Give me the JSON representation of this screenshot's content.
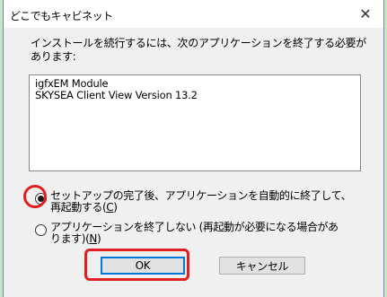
{
  "window": {
    "title": "どこでもキャビネット",
    "close_glyph": "✕"
  },
  "message": "インストールを続行するには、次のアプリケーションを終了する必要があります:",
  "applications": [
    "igfxEM Module",
    "SKYSEA Client View Version 13.2"
  ],
  "options": [
    {
      "label_line1": "セットアップの完了後、アプリケーションを自動的に終了して、",
      "label_line2_prefix": "再起動する(",
      "accel": "C",
      "label_line2_suffix": ")",
      "checked": true
    },
    {
      "label_line1": "アプリケーションを終了しない (再起動が必要になる場合があ",
      "label_line2_prefix": "ります)(",
      "accel": "N",
      "label_line2_suffix": ")",
      "checked": false
    }
  ],
  "buttons": {
    "ok": "OK",
    "cancel": "キャンセル"
  },
  "colors": {
    "highlight": "#e02020",
    "background": "#c9e4c0"
  }
}
